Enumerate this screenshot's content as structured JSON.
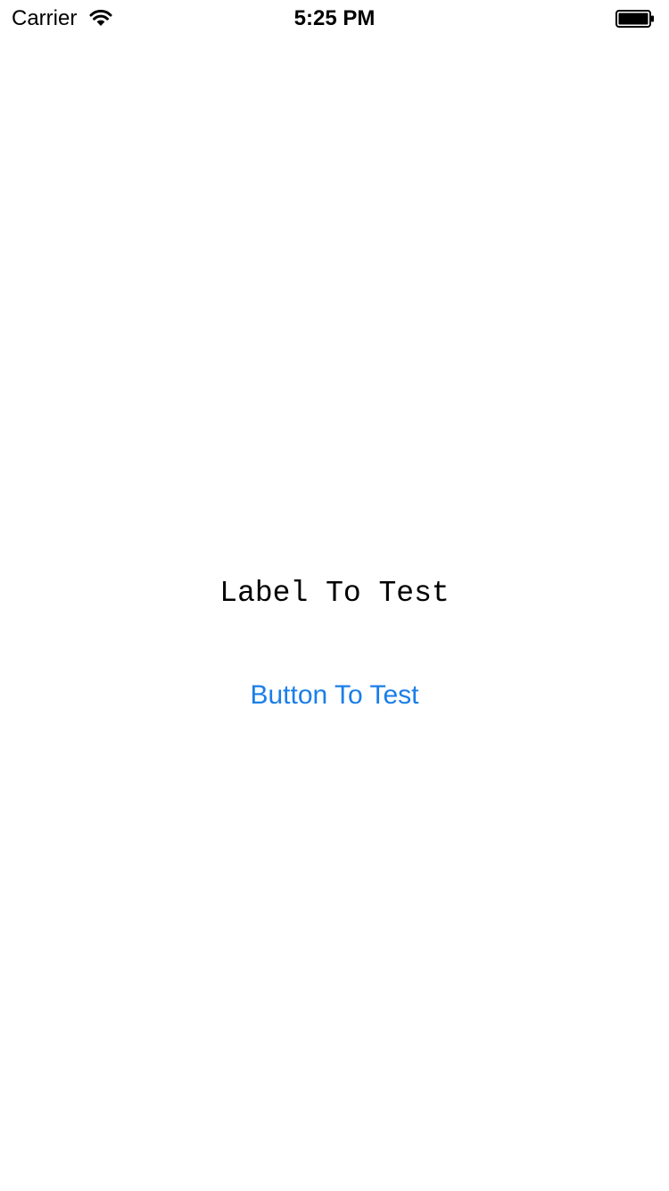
{
  "status_bar": {
    "carrier": "Carrier",
    "time": "5:25 PM",
    "icons": [
      "wifi-icon",
      "battery-icon"
    ]
  },
  "main": {
    "label_text": "Label To Test",
    "button_label": "Button To Test"
  },
  "colors": {
    "button_tint": "#1a7ee8",
    "text": "#000000",
    "background": "#ffffff"
  }
}
